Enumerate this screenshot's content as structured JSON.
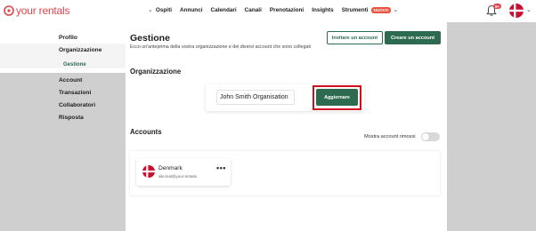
{
  "brand": {
    "name": "your rentals",
    "color": "#e0454c"
  },
  "nav": {
    "items": [
      {
        "label": "Ospiti",
        "has_dropdown": true
      },
      {
        "label": "Annunci"
      },
      {
        "label": "Calendari"
      },
      {
        "label": "Canali"
      },
      {
        "label": "Prenotazioni"
      },
      {
        "label": "Insights"
      },
      {
        "label": "Strumenti",
        "badge": "NUOVO",
        "has_dropdown": true
      }
    ]
  },
  "header": {
    "notifications_count": "9+",
    "avatar_icon": "denmark-flag"
  },
  "sidebar": {
    "items": [
      {
        "label": "Profilo"
      },
      {
        "label": "Organizzazione",
        "active": true,
        "subitems": [
          {
            "label": "Gestione",
            "active": true
          }
        ]
      },
      {
        "label": "Account"
      },
      {
        "label": "Transazioni"
      },
      {
        "label": "Collaboratori"
      },
      {
        "label": "Risposta"
      }
    ]
  },
  "page": {
    "title": "Gestione",
    "subtitle": "Ecco un'anteprima della vostra organizzazione e dei diversi account che sono collegati",
    "invite_button": "Invitare un account",
    "create_button": "Creare un account"
  },
  "organization": {
    "section_title": "Organizzazione",
    "name_value": "John Smith Organisation",
    "update_button": "Aggiornare"
  },
  "accounts": {
    "section_title": "Accounts",
    "show_removed_label": "Mostra account rimossi",
    "show_removed": false,
    "list": [
      {
        "name": "Denmark",
        "email": "site.test@your-rentals",
        "flag_icon": "denmark-flag"
      }
    ]
  },
  "colors": {
    "accent": "#2d6a4f",
    "highlight": "#d0101e",
    "flag_red": "#c8102e"
  }
}
